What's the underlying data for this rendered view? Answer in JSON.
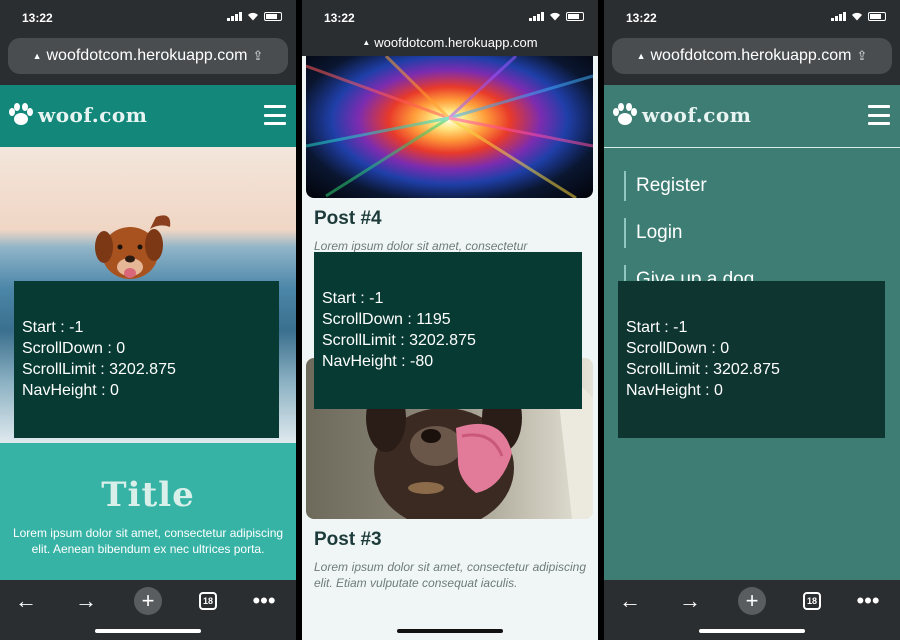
{
  "status": {
    "time": "13:22"
  },
  "browser": {
    "url": "woofdotcom.herokuapp.com",
    "tab_count": "18"
  },
  "site": {
    "brand": "woof.com"
  },
  "debug_panels": [
    {
      "start": "Start : -1",
      "scroll_down": "ScrollDown : 0",
      "scroll_limit": "ScrollLimit : 3202.875",
      "nav_height": "NavHeight : 0"
    },
    {
      "start": "Start : -1",
      "scroll_down": "ScrollDown : 1195",
      "scroll_limit": "ScrollLimit : 3202.875",
      "nav_height": "NavHeight : -80"
    },
    {
      "start": "Start : -1",
      "scroll_down": "ScrollDown : 0",
      "scroll_limit": "ScrollLimit : 3202.875",
      "nav_height": "NavHeight : 0"
    }
  ],
  "hero": {
    "title": "Title",
    "text": "Lorem ipsum dolor sit amet, consectetur adipiscing elit. Aenean bibendum ex nec ultrices porta."
  },
  "feed": {
    "post4": {
      "title": "Post #4",
      "excerpt": "Lorem ipsum dolor sit amet, consectetur"
    },
    "post3": {
      "title": "Post #3",
      "excerpt": "Lorem ipsum dolor sit amet, consectetur adipiscing elit. Etiam vulputate consequat iaculis."
    }
  },
  "menu": {
    "items": [
      "Register",
      "Login",
      "Give up a dog"
    ]
  },
  "colors": {
    "nav": "#13887a",
    "debug": "#073a33",
    "section": "#37b3a6",
    "menu_bg": "#3e7d74"
  },
  "icons": {
    "brand": "paw-icon",
    "menu": "hamburger-icon",
    "back": "back-arrow-icon",
    "forward": "forward-arrow-icon",
    "new_tab": "plus-icon",
    "tabs": "tabs-icon",
    "more": "more-icon"
  }
}
